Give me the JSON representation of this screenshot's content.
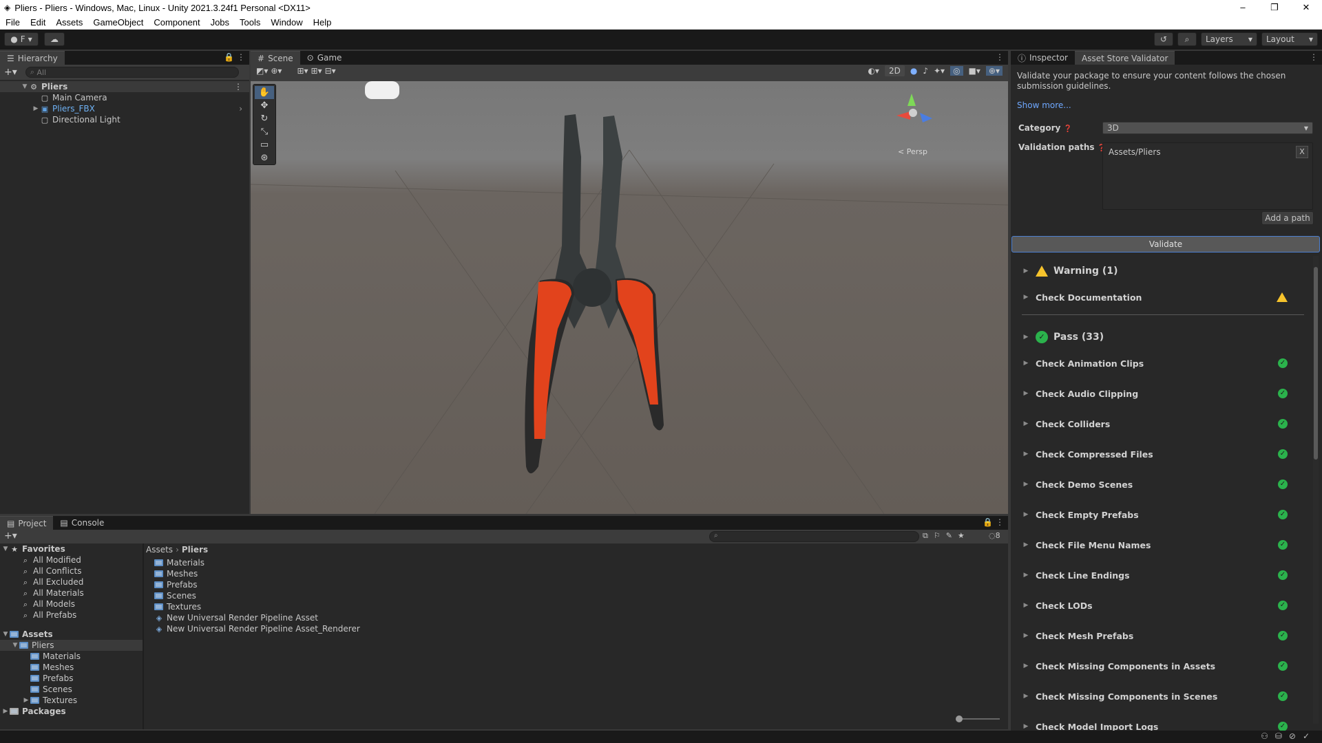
{
  "window": {
    "title": "Pliers - Pliers - Windows, Mac, Linux - Unity 2021.3.24f1 Personal <DX11>",
    "controls": [
      "–",
      "❐",
      "✕"
    ]
  },
  "menu": [
    "File",
    "Edit",
    "Assets",
    "GameObject",
    "Component",
    "Jobs",
    "Tools",
    "Window",
    "Help"
  ],
  "toolbar": {
    "account_label": "F",
    "layers_label": "Layers",
    "layout_label": "Layout"
  },
  "hierarchy": {
    "tab": "Hierarchy",
    "search_placeholder": "All",
    "items": [
      {
        "label": "Pliers"
      },
      {
        "label": "Main Camera"
      },
      {
        "label": "Pliers_FBX"
      },
      {
        "label": "Directional Light"
      }
    ]
  },
  "scene_tabs": {
    "scene": "Scene",
    "game": "Game"
  },
  "scene": {
    "mode_2d": "2D",
    "persp_label": "< Persp"
  },
  "inspector": {
    "tabs": [
      "Inspector",
      "Asset Store Validator"
    ],
    "description": "Validate your package to ensure your content follows the chosen submission guidelines.",
    "show_more": "Show more...",
    "category_label": "Category",
    "category_value": "3D",
    "paths_label": "Validation paths",
    "path_value": "Assets/Pliers",
    "path_remove": "X",
    "add_path": "Add a path",
    "validate": "Validate",
    "warning_header": "Warning (1)",
    "warning_items": [
      "Check Documentation"
    ],
    "pass_header": "Pass (33)",
    "pass_items": [
      "Check Animation Clips",
      "Check Audio Clipping",
      "Check Colliders",
      "Check Compressed Files",
      "Check Demo Scenes",
      "Check Empty Prefabs",
      "Check File Menu Names",
      "Check Line Endings",
      "Check LODs",
      "Check Mesh Prefabs",
      "Check Missing Components in Assets",
      "Check Missing Components in Scenes",
      "Check Model Import Logs"
    ]
  },
  "project": {
    "tabs": [
      "Project",
      "Console"
    ],
    "hidden_count": "8",
    "favorites_label": "Favorites",
    "favorites": [
      "All Modified",
      "All Conflicts",
      "All Excluded",
      "All Materials",
      "All Models",
      "All Prefabs"
    ],
    "assets_label": "Assets",
    "assets_tree": [
      "Pliers",
      "Materials",
      "Meshes",
      "Prefabs",
      "Scenes",
      "Textures"
    ],
    "packages_label": "Packages",
    "breadcrumb": [
      "Assets",
      "Pliers"
    ],
    "files": [
      "Materials",
      "Meshes",
      "Prefabs",
      "Scenes",
      "Textures",
      "New Universal Render Pipeline Asset",
      "New Universal Render Pipeline Asset_Renderer"
    ]
  },
  "colors": {
    "accent": "#4c7fd1",
    "pass": "#2bb24c",
    "warning": "#f6c32c",
    "handle_orange": "#e2431c"
  }
}
